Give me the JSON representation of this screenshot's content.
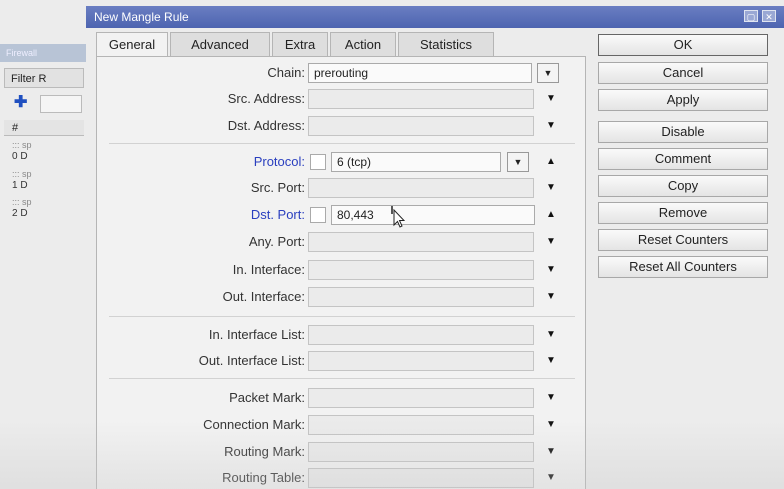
{
  "background_window": {
    "title": "Firewall",
    "tab": "Filter R",
    "column_header": "#",
    "rows": [
      {
        "sub": "::: sp",
        "num": "0",
        "flag": "D"
      },
      {
        "sub": "::: sp",
        "num": "1",
        "flag": "D"
      },
      {
        "sub": "::: sp",
        "num": "2",
        "flag": "D"
      }
    ]
  },
  "dialog": {
    "title": "New Mangle Rule",
    "controls": [
      "▢",
      "✕"
    ]
  },
  "tabs": [
    "General",
    "Advanced",
    "Extra",
    "Action",
    "Statistics"
  ],
  "fields": {
    "chain": {
      "label": "Chain:",
      "value": "prerouting"
    },
    "src_address": {
      "label": "Src. Address:",
      "value": ""
    },
    "dst_address": {
      "label": "Dst. Address:",
      "value": ""
    },
    "protocol": {
      "label": "Protocol:",
      "value": "6 (tcp)"
    },
    "src_port": {
      "label": "Src. Port:",
      "value": ""
    },
    "dst_port": {
      "label": "Dst. Port:",
      "value": "80,443"
    },
    "any_port": {
      "label": "Any. Port:",
      "value": ""
    },
    "in_interface": {
      "label": "In. Interface:",
      "value": ""
    },
    "out_interface": {
      "label": "Out. Interface:",
      "value": ""
    },
    "in_interface_list": {
      "label": "In. Interface List:",
      "value": ""
    },
    "out_interface_list": {
      "label": "Out. Interface List:",
      "value": ""
    },
    "packet_mark": {
      "label": "Packet Mark:",
      "value": ""
    },
    "connection_mark": {
      "label": "Connection Mark:",
      "value": ""
    },
    "routing_mark": {
      "label": "Routing Mark:",
      "value": ""
    },
    "routing_table": {
      "label": "Routing Table:",
      "value": ""
    }
  },
  "buttons": {
    "ok": "OK",
    "cancel": "Cancel",
    "apply": "Apply",
    "disable": "Disable",
    "comment": "Comment",
    "copy": "Copy",
    "remove": "Remove",
    "reset_counters": "Reset Counters",
    "reset_all_counters": "Reset All Counters"
  },
  "colors": {
    "titlebar": "#5a70b8",
    "blue_label": "#2a3fbf"
  }
}
